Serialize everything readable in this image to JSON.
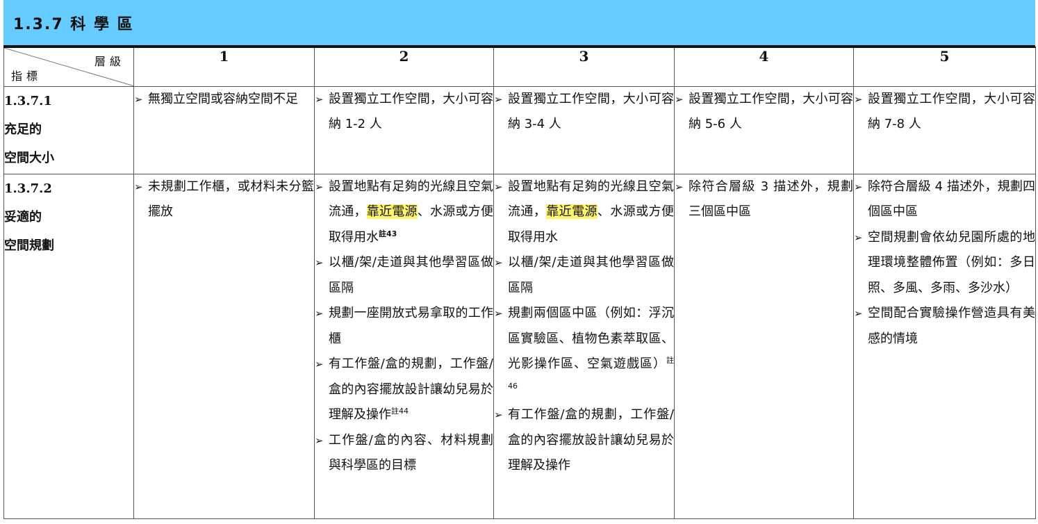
{
  "section": {
    "title": "1.3.7 科 學 區"
  },
  "header": {
    "corner_top": "層級",
    "corner_bottom": "指標",
    "levels": [
      "1",
      "2",
      "3",
      "4",
      "5"
    ]
  },
  "bullet_symbol": "➢",
  "rows": [
    {
      "code": "1.3.7.1",
      "name_line1": "充足的",
      "name_line2": "空間大小",
      "cells": [
        [
          "無獨立空間或容納空間不足"
        ],
        [
          "設置獨立工作空間，大小可容納 1-2 人"
        ],
        [
          "設置獨立工作空間，大小可容納 3-4 人"
        ],
        [
          "設置獨立工作空間，大小可容納 5-6 人"
        ],
        [
          "設置獨立工作空間，大小可容納 7-8 人"
        ]
      ]
    },
    {
      "code": "1.3.7.2",
      "name_line1": "妥適的",
      "name_line2": "空間規劃",
      "level1": [
        "未規劃工作櫃，或材料未分籃擺放"
      ],
      "level2": {
        "item1_a": "設置地點有足夠的光線且空氣流通，",
        "item1_highlight": "靠近電源",
        "item1_b": "、水源或方便取得用水",
        "item1_note": "註43",
        "item2": "以櫃/架/走道與其他學習區做區隔",
        "item3": "規劃一座開放式易拿取的工作櫃",
        "item4": "有工作盤/盒的規劃，工作盤/盒的內容擺放設計讓幼兒易於理解及操作",
        "item4_note": "註44",
        "item5": "工作盤/盒的內容、材料規劃與科學區的目標"
      },
      "level3": {
        "item1_a": "設置地點有足夠的光線且空氣流通，",
        "item1_highlight": "靠近電源",
        "item1_b": "、水源或方便取得用水",
        "item2": "以櫃/架/走道與其他學習區做區隔",
        "item3": "規劃兩個區中區（例如：浮沉區實驗區、植物色素萃取區、光影操作區、空氣遊戲區）",
        "item3_note": "註46",
        "item4": "有工作盤/盒的規劃，工作盤/盒的內容擺放設計讓幼兒易於理解及操作"
      },
      "level4": [
        "除符合層級 3 描述外，規劃三個區中區"
      ],
      "level5": [
        "除符合層級 4 描述外，規劃四個區中區",
        "空間規劃會依幼兒園所處的地理環境整體佈置（例如：多日照、多風、多雨、多沙水）",
        "空間配合實驗操作營造具有美感的情境"
      ]
    }
  ]
}
